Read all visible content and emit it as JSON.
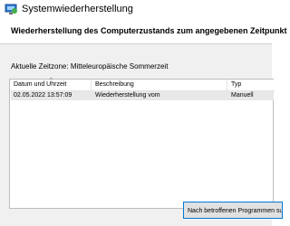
{
  "window": {
    "title": "Systemwiederherstellung",
    "icon": "system-restore-icon"
  },
  "header": {
    "title": "Wiederherstellung des Computerzustands zum angegebenen Zeitpunkt"
  },
  "timezone": {
    "label": "Aktuelle Zeitzone: Mitteleuropäische Sommerzeit"
  },
  "table": {
    "columns": [
      "Datum und Uhrzeit",
      "Beschreibung",
      "Typ"
    ],
    "sort_glyph": "^",
    "rows": [
      {
        "date": "02.05.2022 13:57:09",
        "description": "Wiederherstellung vom",
        "type": "Manuell",
        "selected": true
      }
    ]
  },
  "buttons": {
    "scan_label": "Nach betroffenen Programmen suchen"
  },
  "colors": {
    "selection": "#e8e8e8",
    "accent": "#0078d7",
    "panel": "#f0f0f0"
  }
}
